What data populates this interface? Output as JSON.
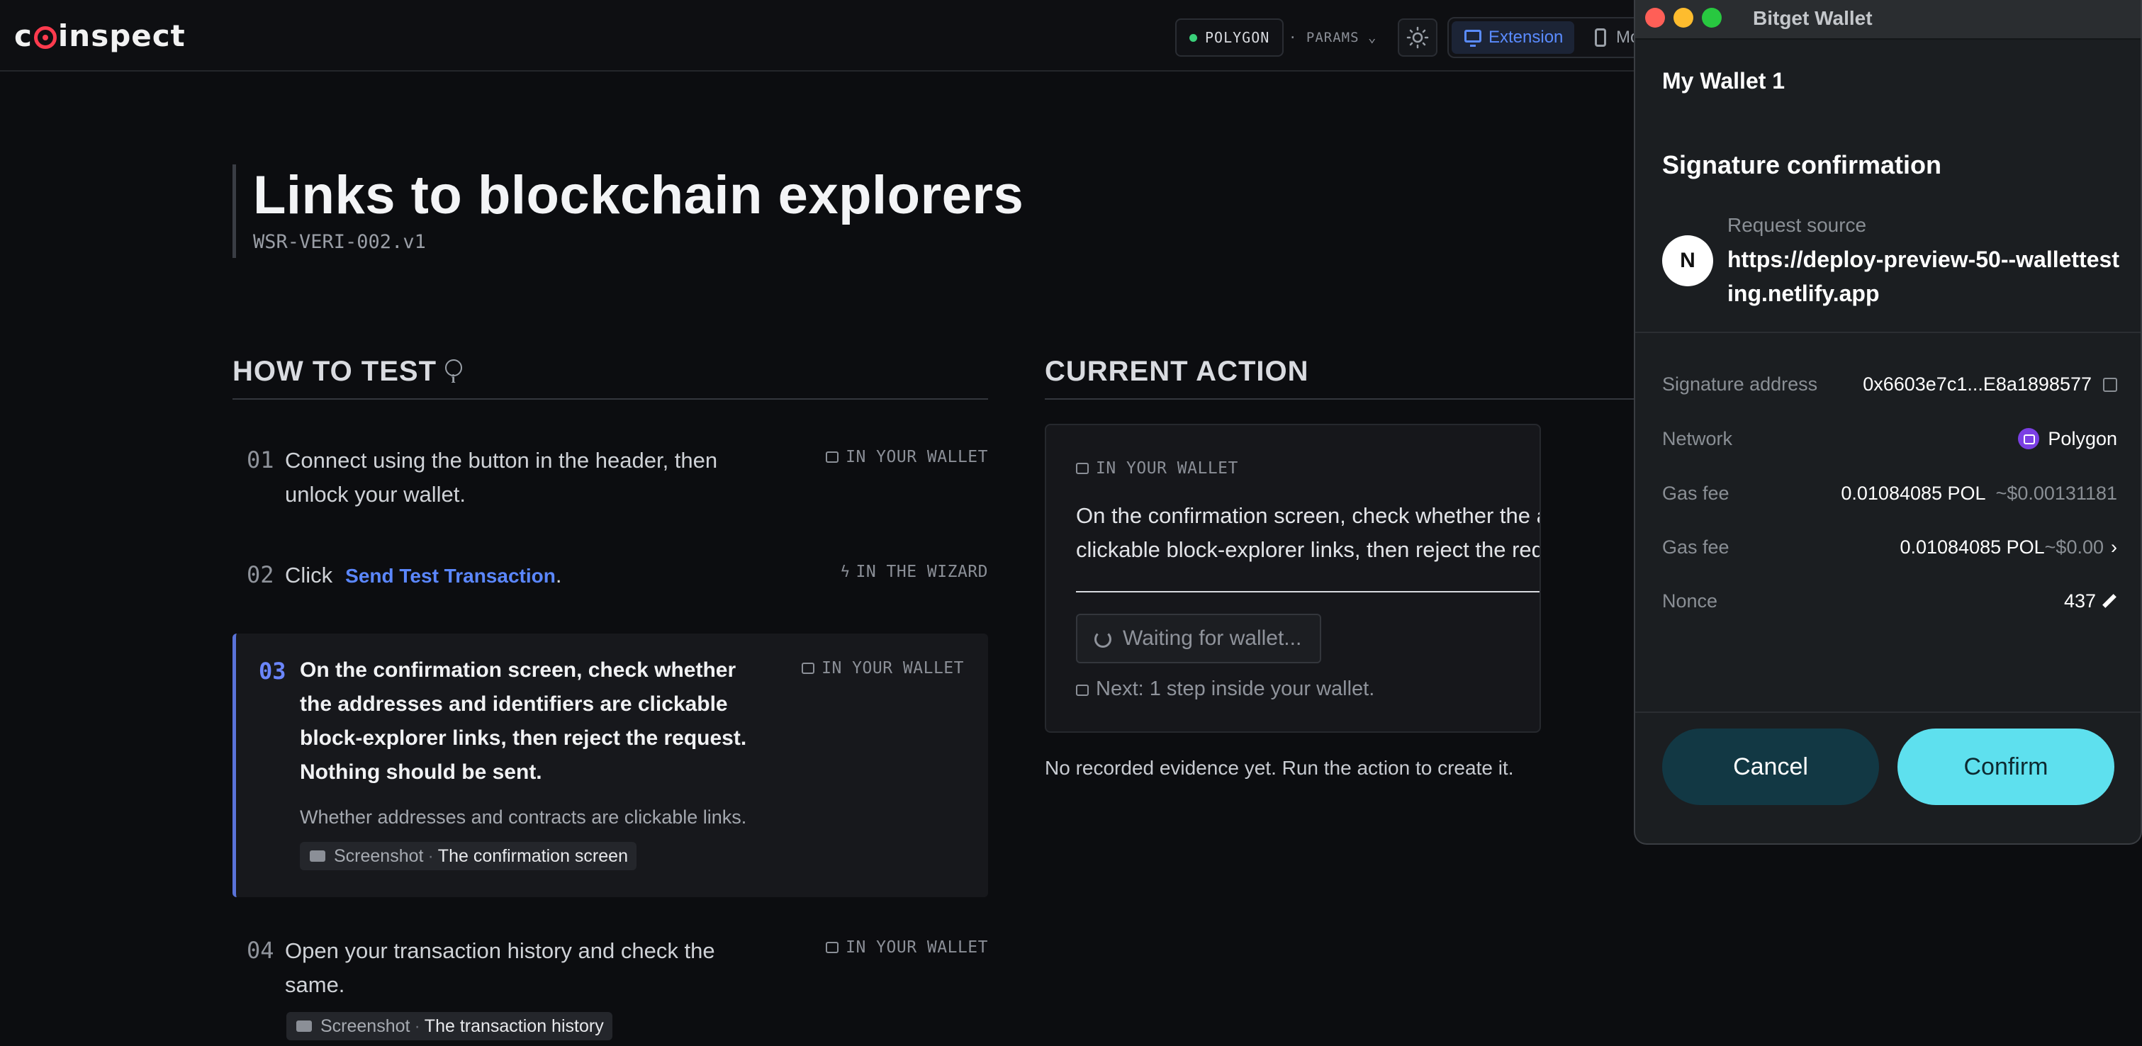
{
  "header": {
    "logo_text": "coinspect",
    "network_chip": "POLYGON",
    "params_label": "· PARAMS ⌄",
    "mode_extension": "Extension",
    "mode_mobile": "Mobile"
  },
  "page": {
    "title": "Links to blockchain explorers",
    "code": "WSR-VERI-002.v1"
  },
  "how_to_test": {
    "heading": "HOW TO TEST",
    "steps": [
      {
        "num": "01",
        "text_line1": "Connect using the button in the header, then",
        "text_line2": "unlock your wallet.",
        "tag": "IN YOUR WALLET"
      },
      {
        "num": "02",
        "text": "Click",
        "link": "Send Test Transaction",
        "suffix": ".",
        "tag": "IN THE WIZARD"
      },
      {
        "num": "03",
        "text_line1": "On the confirmation screen, check whether",
        "text_line2": "the addresses and identifiers are clickable",
        "text_line3": "block-explorer links, then reject the request.",
        "text_line4": "Nothing should be sent.",
        "tag": "IN YOUR WALLET",
        "note": "Whether addresses and contracts are clickable links.",
        "evidence_kind": "Screenshot",
        "evidence_name": "The confirmation screen"
      },
      {
        "num": "04",
        "text_line1": "Open your transaction history and check the",
        "text_line2": "same.",
        "tag": "IN YOUR WALLET",
        "evidence_kind": "Screenshot",
        "evidence_name": "The transaction history"
      }
    ]
  },
  "current_action": {
    "heading": "CURRENT ACTION",
    "tag": "IN YOUR WALLET",
    "text_line1": "On the confirmation screen, check whether the addresses and identifiers are",
    "text_line2": "clickable block-explorer links, then reject the request. Nothing should be sent.",
    "waiting_button": "Waiting for wallet...",
    "next_line": "Next: 1 step inside your wallet.",
    "no_evidence": "No recorded evidence yet. Run the action to create it."
  },
  "wallet": {
    "window_title": "Bitget Wallet",
    "account": "My Wallet 1",
    "heading": "Signature confirmation",
    "avatar_letter": "N",
    "request_source_label": "Request source",
    "request_source_url": "https://deploy-preview-50--wallettesting.netlify.app",
    "rows": {
      "sig_address_label": "Signature address",
      "sig_address_value": "0x6603e7c1...E8a1898577",
      "network_label": "Network",
      "network_value": "Polygon",
      "gas1_label": "Gas fee",
      "gas1_value": "0.01084085 POL",
      "gas1_fiat": "~$0.00131181",
      "gas2_label": "Gas fee",
      "gas2_value": "0.01084085 POL",
      "gas2_fiat": "~$0.00",
      "nonce_label": "Nonce",
      "nonce_value": "437"
    },
    "cancel_label": "Cancel",
    "confirm_label": "Confirm"
  },
  "colors": {
    "background": "#0c0d10",
    "accent_blue": "#5b87ff",
    "wallet_confirm": "#5ee0ee",
    "wallet_cancel": "#123844",
    "network_dot": "#3ad07a",
    "logo_red": "#ff3b4e",
    "polygon_purple": "#7b3fe4"
  },
  "icons": [
    "coinspect-logo",
    "network-status-dot",
    "chevron-down-icon",
    "sun-icon",
    "monitor-icon",
    "phone-icon",
    "info-icon",
    "wallet-icon",
    "bolt-icon",
    "camera-icon",
    "refresh-icon",
    "copy-icon",
    "polygon-icon",
    "chevron-right-icon",
    "pencil-icon"
  ]
}
